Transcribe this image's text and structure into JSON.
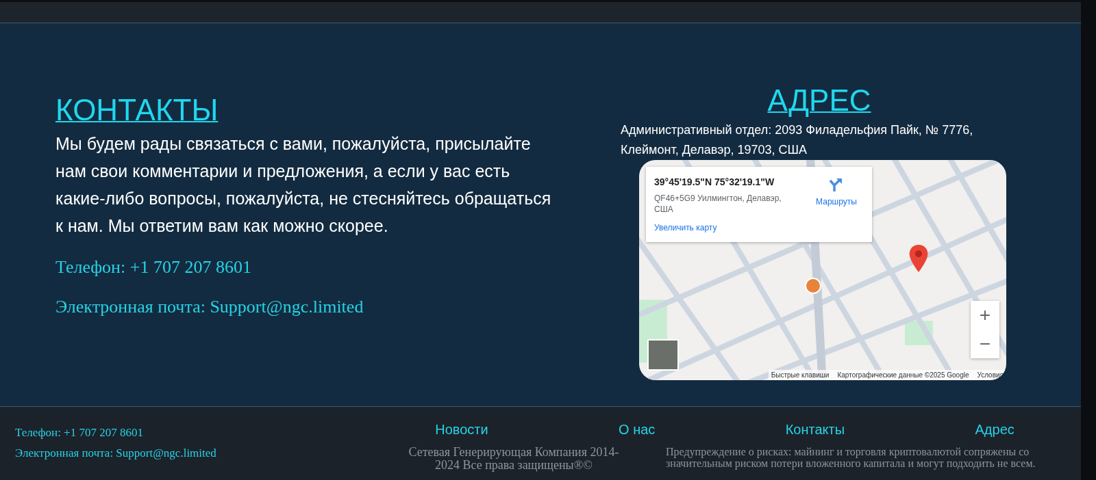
{
  "contacts": {
    "title": "КОНТАКТЫ",
    "text": "Мы будем рады связаться с вами, пожалуйста, присылайте нам свои комментарии и предложения, а если у вас есть какие-либо вопросы, пожалуйста, не стесняйтесь обращаться к нам. Мы ответим вам как можно скорее.",
    "phone": "Телефон: +1 707 207 8601",
    "email": "Электронная почта: Support@ngc.limited"
  },
  "address": {
    "title": "АДРЕС",
    "text": "Административный отдел: 2093 Филадельфия Пайк, № 7776, Клеймонт, Делавэр, 19703, США",
    "map": {
      "coordinates": "39°45'19.5\"N 75°32'19.1\"W",
      "place": "QF46+5G9 Уилмингтон, Делавэр, США",
      "directions": "Маршруты",
      "enlarge": "Увеличить карту",
      "zoom_in": "+",
      "zoom_out": "−",
      "attribution": [
        "Быстрые клавиши",
        "Картографические данные ©2025 Google",
        "Условия"
      ]
    }
  },
  "footer": {
    "phone": "Телефон: +1 707 207 8601",
    "email": "Электронная почта: Support@ngc.limited",
    "nav": [
      "Новости",
      "О нас",
      "Контакты",
      "Адрес"
    ],
    "copyright": "Сетевая Генерирующая Компания 2014-2024 Все права защищены®©",
    "risk": "Предупреждение о рисках: майнинг и торговля криптовалютой сопряжены со значительным риском потери вложенного капитала и могут подходить не всем."
  }
}
